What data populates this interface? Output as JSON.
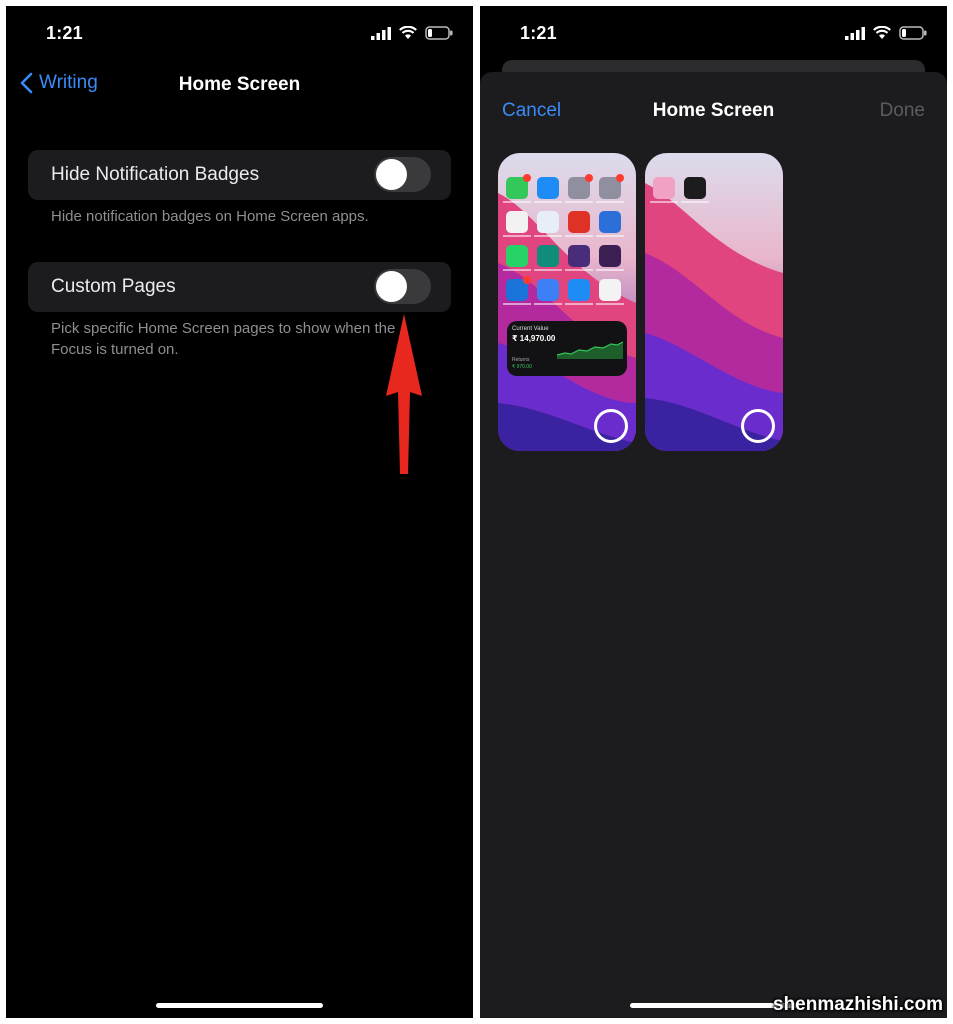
{
  "left": {
    "status": {
      "time": "1:21"
    },
    "nav": {
      "back_label": "Writing",
      "title": "Home Screen"
    },
    "settings": [
      {
        "label": "Hide Notification Badges",
        "on": false,
        "footnote": "Hide notification badges on Home Screen apps."
      },
      {
        "label": "Custom Pages",
        "on": false,
        "footnote": "Pick specific Home Screen pages to show when the Focus is turned on."
      }
    ]
  },
  "right": {
    "status": {
      "time": "1:21"
    },
    "sheet": {
      "cancel_label": "Cancel",
      "title": "Home Screen",
      "done_label": "Done"
    },
    "pages": [
      {
        "selected": false,
        "widget": {
          "title": "Current Value",
          "value": "₹ 14,970.00",
          "returns_label": "Returns",
          "returns": "₹ 970.00"
        }
      },
      {
        "selected": false
      }
    ]
  },
  "watermark": "shenmazhishi.com",
  "colors": {
    "accent": "#3a8af7",
    "cell": "#1c1c1e",
    "annotation_arrow": "#e8281e"
  }
}
